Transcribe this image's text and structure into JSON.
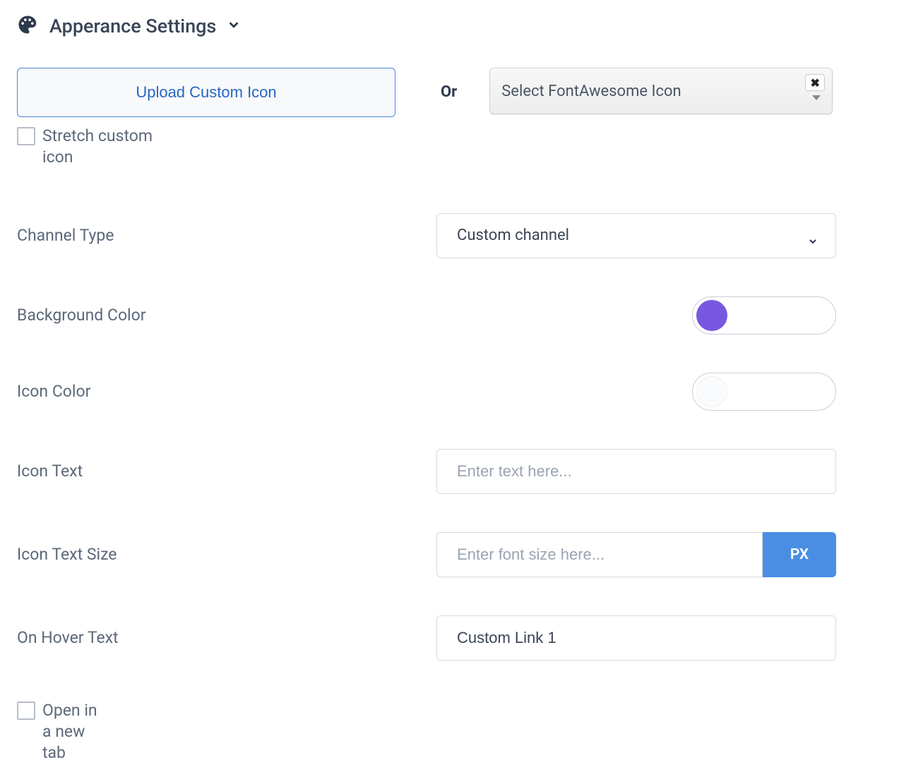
{
  "header": {
    "title": "Apperance Settings"
  },
  "upload": {
    "button_label": "Upload Custom Icon",
    "stretch_checkbox_label": "Stretch custom icon",
    "stretch_checked": false
  },
  "or_label": "Or",
  "fontawesome": {
    "placeholder": "Select FontAwesome Icon",
    "clear_symbol": "✖"
  },
  "fields": {
    "channel_type": {
      "label": "Channel Type",
      "value": "Custom channel"
    },
    "background_color": {
      "label": "Background Color",
      "hex": "#7858e0"
    },
    "icon_color": {
      "label": "Icon Color",
      "hex": "#fafbfc"
    },
    "icon_text": {
      "label": "Icon Text",
      "placeholder": "Enter text here...",
      "value": ""
    },
    "icon_text_size": {
      "label": "Icon Text Size",
      "placeholder": "Enter font size here...",
      "value": "",
      "unit": "PX"
    },
    "on_hover_text": {
      "label": "On Hover Text",
      "value": "Custom Link 1"
    },
    "open_new_tab": {
      "label": "Open in a new tab",
      "checked": false
    }
  }
}
